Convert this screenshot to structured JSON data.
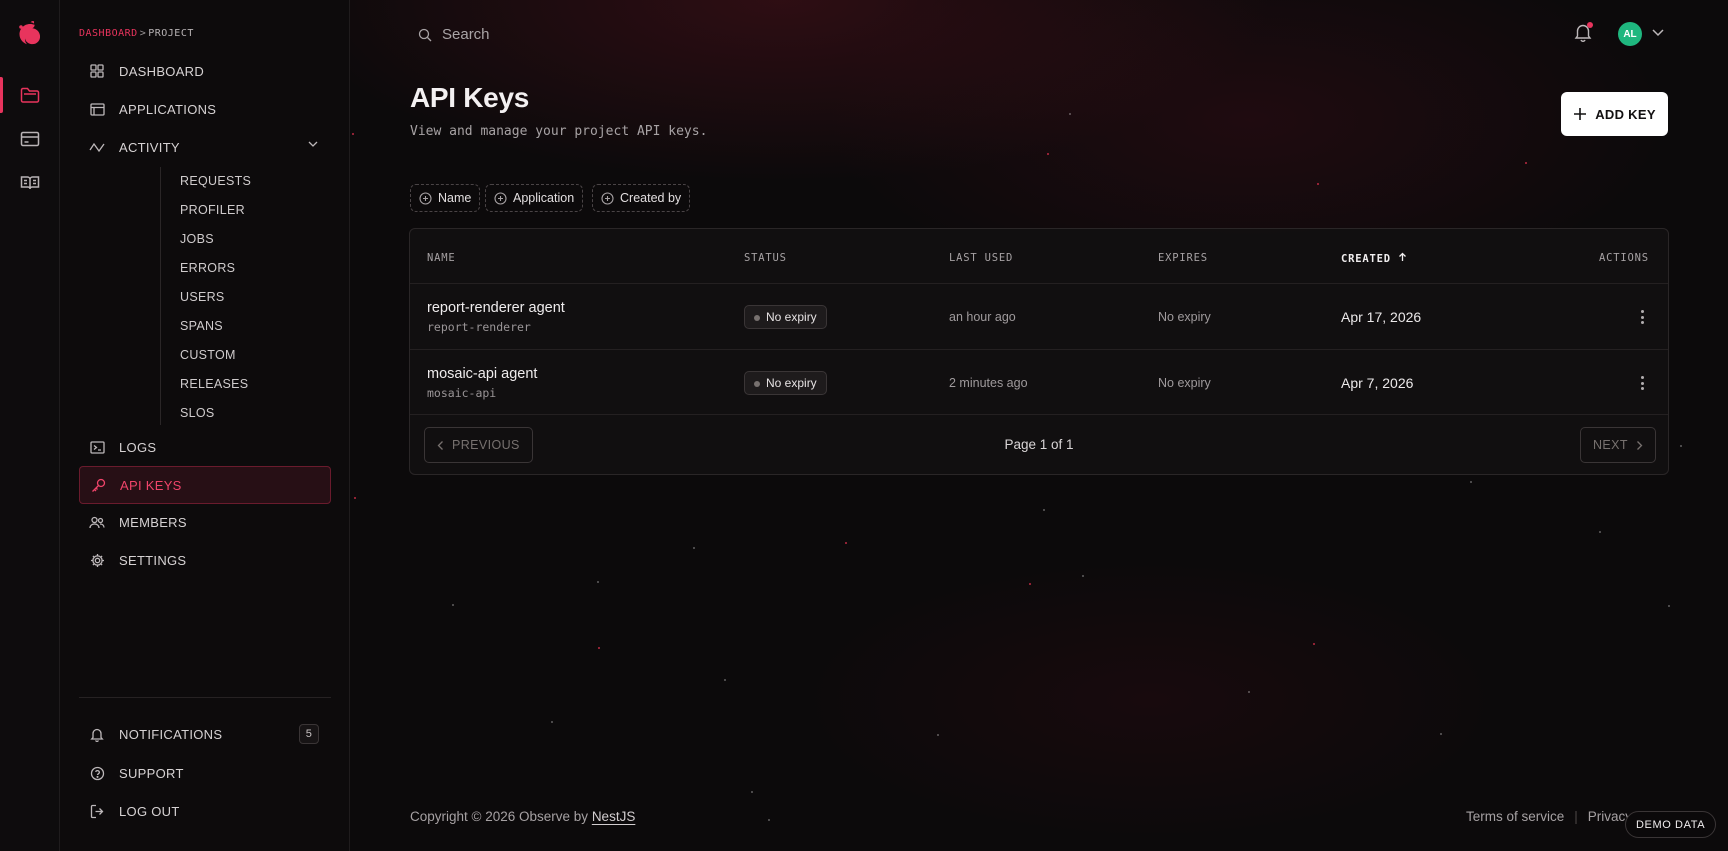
{
  "colors": {
    "accent": "#e8345d",
    "avatar": "#1fb77f",
    "background": "#0c0a0b"
  },
  "breadcrumb": {
    "first": "DASHBOARD",
    "separator": ">",
    "second": "PROJECT"
  },
  "rail": {
    "icons": [
      "folder-icon",
      "credit-card-icon",
      "book-open-icon"
    ]
  },
  "sidebar": {
    "items": [
      {
        "label": "DASHBOARD",
        "icon": "grid-icon"
      },
      {
        "label": "APPLICATIONS",
        "icon": "window-icon"
      },
      {
        "label": "ACTIVITY",
        "icon": "activity-icon"
      },
      {
        "label": "LOGS",
        "icon": "terminal-icon"
      },
      {
        "label": "API KEYS",
        "icon": "key-icon"
      },
      {
        "label": "MEMBERS",
        "icon": "users-icon"
      },
      {
        "label": "SETTINGS",
        "icon": "gear-icon"
      }
    ],
    "activity_sub": [
      "REQUESTS",
      "PROFILER",
      "JOBS",
      "ERRORS",
      "USERS",
      "SPANS",
      "CUSTOM",
      "RELEASES",
      "SLOS"
    ],
    "bottom": [
      {
        "label": "NOTIFICATIONS",
        "icon": "bell-icon",
        "count": "5"
      },
      {
        "label": "SUPPORT",
        "icon": "help-circle-icon"
      },
      {
        "label": "LOG OUT",
        "icon": "logout-icon"
      }
    ]
  },
  "header": {
    "search_placeholder": "Search",
    "avatar_initials": "AL"
  },
  "page": {
    "title": "API Keys",
    "subtitle": "View and manage your project API keys.",
    "add_button": "ADD KEY"
  },
  "filters": [
    "Name",
    "Application",
    "Created by"
  ],
  "table": {
    "columns": [
      "NAME",
      "STATUS",
      "LAST USED",
      "EXPIRES",
      "CREATED",
      "ACTIONS"
    ],
    "sorted_column": "CREATED",
    "rows": [
      {
        "name": "report-renderer agent",
        "slug": "report-renderer",
        "status": "No expiry",
        "last_used": "an hour ago",
        "expires": "No expiry",
        "created": "Apr 17, 2026"
      },
      {
        "name": "mosaic-api agent",
        "slug": "mosaic-api",
        "status": "No expiry",
        "last_used": "2 minutes ago",
        "expires": "No expiry",
        "created": "Apr 7, 2026"
      }
    ],
    "pagination": {
      "previous": "PREVIOUS",
      "info": "Page 1 of 1",
      "next": "NEXT"
    }
  },
  "footer": {
    "copyright_prefix": "Copyright © 2026 Observe by",
    "copyright_link": "NestJS",
    "terms": "Terms of service",
    "privacy": "Privacy",
    "demo_badge": "DEMO DATA"
  }
}
